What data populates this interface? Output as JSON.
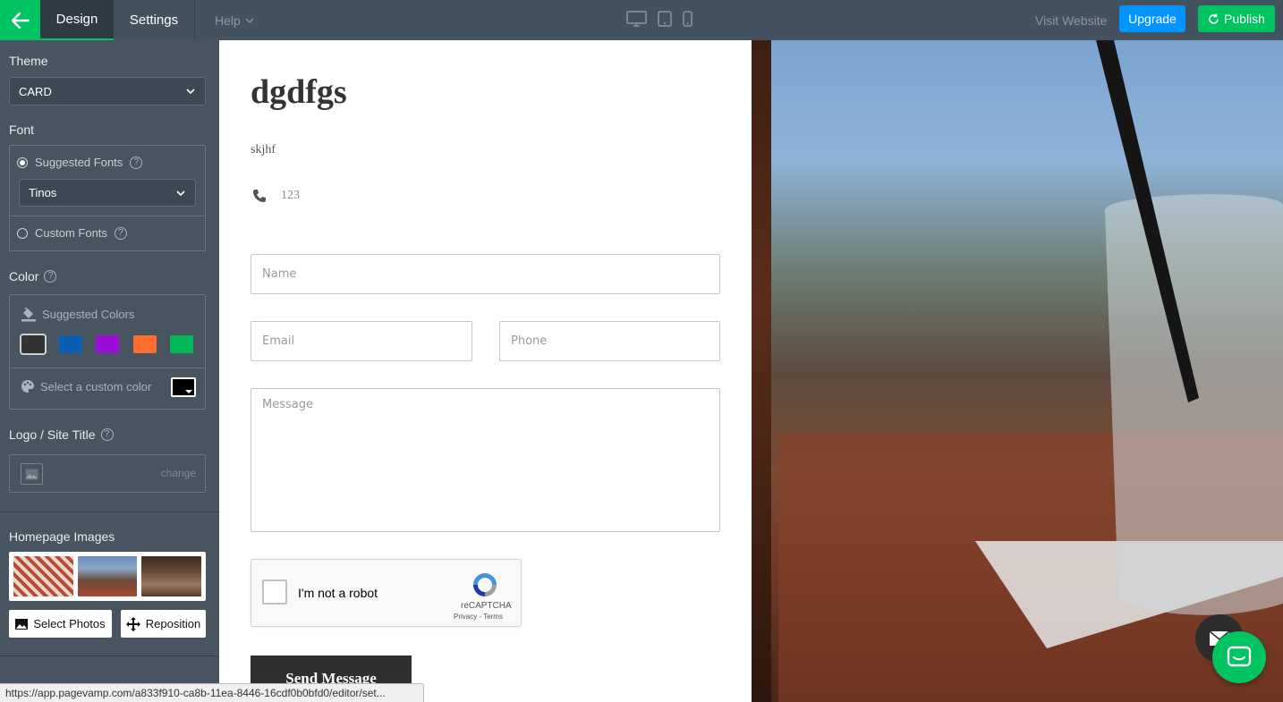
{
  "topbar": {
    "tabs": [
      "Design",
      "Settings"
    ],
    "help": "Help",
    "visit": "Visit Website",
    "upgrade": "Upgrade",
    "publish": "Publish",
    "accent": "#00c462",
    "upgrade_color": "#0095ff"
  },
  "sidebar": {
    "theme_label": "Theme",
    "theme_value": "CARD",
    "font_label": "Font",
    "suggested_fonts": "Suggested Fonts",
    "font_value": "Tinos",
    "custom_fonts": "Custom Fonts",
    "color_label": "Color",
    "suggested_colors": "Suggested Colors",
    "swatches": [
      "#333333",
      "#0a5fb3",
      "#9b0ed6",
      "#ff6c2f",
      "#00b859"
    ],
    "custom_color": "Select a custom color",
    "logo_label": "Logo / Site Title",
    "logo_change": "change",
    "homepage_images": "Homepage Images",
    "select_photos": "Select Photos",
    "reposition": "Reposition"
  },
  "content": {
    "title": "dgdfgs",
    "subtitle": "skjhf",
    "phone": "123",
    "name_placeholder": "Name",
    "email_placeholder": "Email",
    "phone_placeholder": "Phone",
    "message_placeholder": "Message",
    "captcha_label": "I'm not a robot",
    "captcha_brand": "reCAPTCHA",
    "captcha_links": "Privacy - Terms",
    "send": "Send Message"
  },
  "status_url": "https://app.pagevamp.com/a833f910-ca8b-11ea-8446-16cdf0b0bfd0/editor/set..."
}
